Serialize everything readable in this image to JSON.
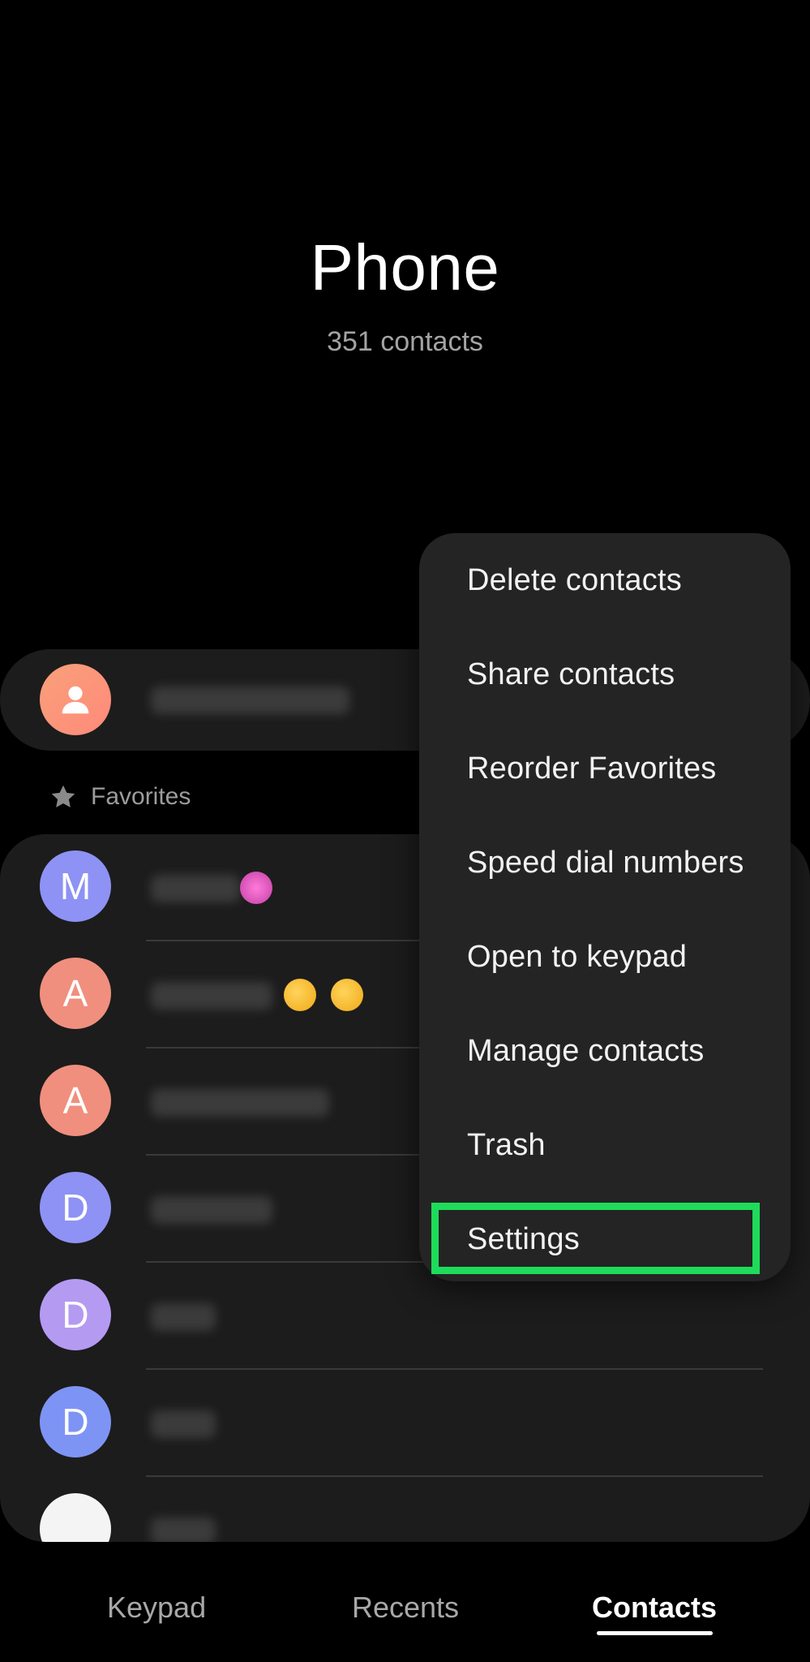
{
  "header": {
    "title": "Phone",
    "subtitle": "351 contacts"
  },
  "favorites": {
    "label": "Favorites"
  },
  "contacts": [
    {
      "initial": "M",
      "color": "#8e92f4"
    },
    {
      "initial": "A",
      "color": "#f08f7e"
    },
    {
      "initial": "A",
      "color": "#f08f7e"
    },
    {
      "initial": "D",
      "color": "#8e92f4"
    },
    {
      "initial": "D",
      "color": "#b59af2"
    },
    {
      "initial": "D",
      "color": "#7e94f5"
    },
    {
      "initial": "",
      "color": "#f4f4f4"
    }
  ],
  "menu": {
    "items": [
      "Delete contacts",
      "Share contacts",
      "Reorder Favorites",
      "Speed dial numbers",
      "Open to keypad",
      "Manage contacts",
      "Trash",
      "Settings"
    ],
    "highlighted": "Settings",
    "highlight_color": "#1edc5a"
  },
  "bottom_nav": {
    "tabs": [
      "Keypad",
      "Recents",
      "Contacts"
    ],
    "active": "Contacts"
  }
}
